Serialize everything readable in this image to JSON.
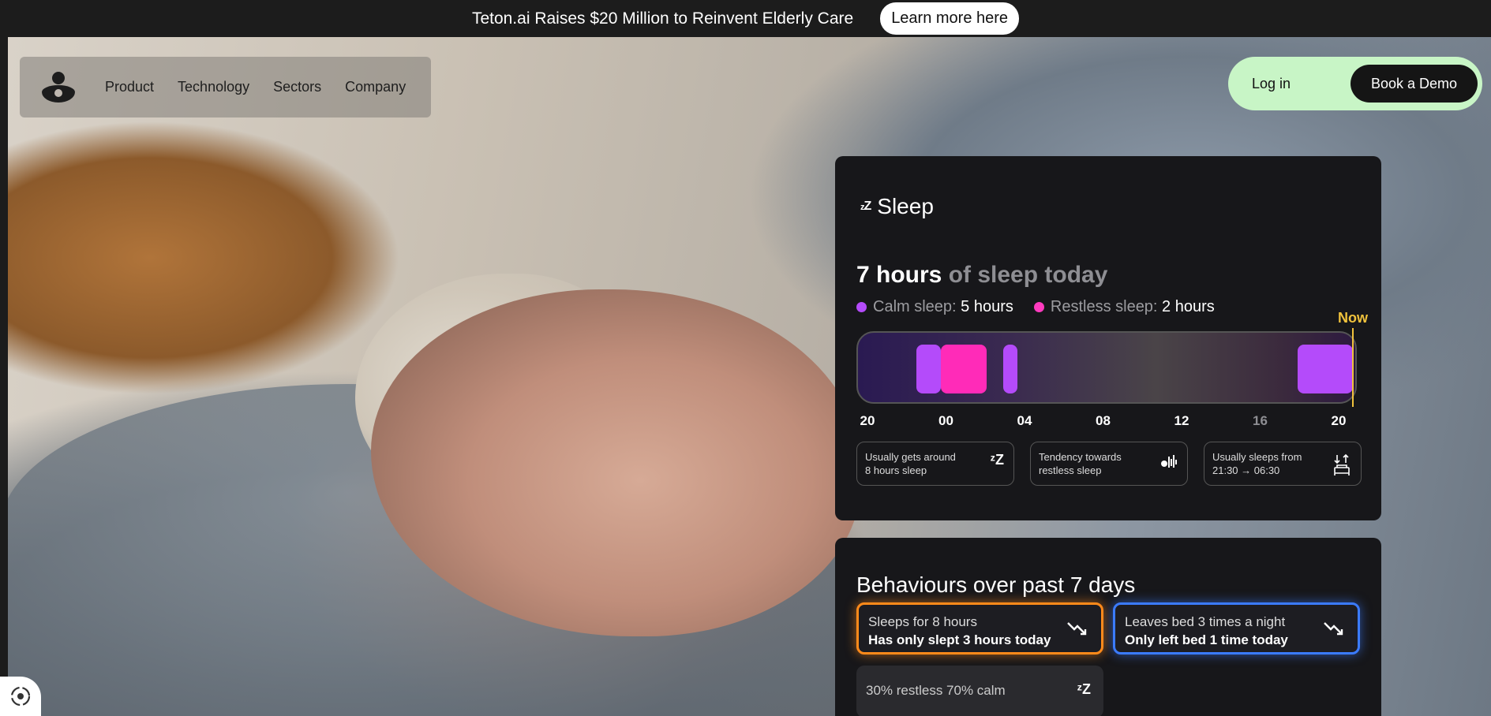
{
  "announcement": {
    "text": "Teton.ai Raises $20 Million to Reinvent Elderly Care",
    "button": "Learn more here"
  },
  "nav": {
    "links": [
      "Product",
      "Technology",
      "Sectors",
      "Company"
    ]
  },
  "auth": {
    "login": "Log in",
    "demo": "Book a Demo"
  },
  "sleep": {
    "title": "Sleep",
    "icon": "zz-icon",
    "hours_strong": "7 hours",
    "hours_muted": " of sleep today",
    "calm_label": "Calm sleep: ",
    "calm_value": "5 hours",
    "restless_label": "Restless sleep: ",
    "restless_value": "2 hours",
    "now_label": "Now",
    "colors": {
      "calm": "#b44bfa",
      "restless": "#ff2bb8",
      "now": "#f0c23c"
    },
    "ticks": [
      "20",
      "00",
      "04",
      "08",
      "12",
      "16",
      "20"
    ],
    "segments": [
      {
        "type": "calm",
        "start": 22.8,
        "end": 24.0
      },
      {
        "type": "restless",
        "start": 24.0,
        "end": 26.2
      },
      {
        "type": "calm",
        "start": 27.0,
        "end": 27.7
      },
      {
        "type": "calm",
        "start": 41.2,
        "end": 43.9
      }
    ],
    "now_hour": 43.95,
    "info": [
      {
        "line1": "Usually gets around",
        "line2": "8 hours sleep",
        "icon": "zz-icon"
      },
      {
        "line1": "Tendency towards",
        "line2": "restless sleep",
        "icon": "restless-wave-icon"
      },
      {
        "line1": "Usually sleeps from",
        "line2": "21:30 → 06:30",
        "icon": "bed-arrows-icon"
      }
    ]
  },
  "behaviours": {
    "title": "Behaviours over past 7 days",
    "items": [
      {
        "line1": "Sleeps for 8 hours",
        "line2": "Has only slept 3 hours today",
        "color": "#ff8a1a"
      },
      {
        "line1": "Leaves bed 3 times a night",
        "line2": "Only left bed 1 time today",
        "color": "#3b7bff"
      }
    ],
    "summary": "30% restless 70% calm"
  }
}
